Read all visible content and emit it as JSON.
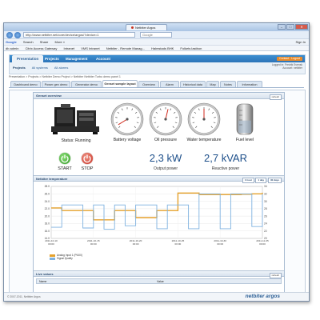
{
  "browser": {
    "tab_title": "Netbiter Argos",
    "url": "http://www.netbiter.net/core/device/argos/?device=1",
    "search_placeholder": "Google",
    "google_toolbar": [
      "Google",
      "Search",
      "Share",
      "More »",
      "Sign In"
    ],
    "favorites": [
      "db admin",
      "Citrix Access Gateway",
      "Intranet",
      "VMS Intranet",
      "Netbiter - Remote Manag...",
      "Halmstads BHK",
      "Folkets lastbon"
    ],
    "window_controls": [
      "–",
      "□",
      "✕"
    ]
  },
  "app": {
    "menu": [
      "Presentation",
      "Projects",
      "Management",
      "Account"
    ],
    "contact_label": "Contact · Logout",
    "subnav": [
      "Projects",
      "All systems",
      "All alarms"
    ],
    "user_line1": "Logged in: Fredrik Svensk",
    "user_line2": "Account: netbiter",
    "breadcrumb": "Presentation > Projects > Netbiter Demo Project > Netbiter Netbiter Turbo demo panel 1"
  },
  "page_tabs": [
    "Dashboard demo",
    "Power gen demo",
    "Generator demo",
    "Genset sample layout",
    "Overview",
    "Alarm",
    "Historical data",
    "Map",
    "Notes",
    "Information"
  ],
  "overview": {
    "title": "Genset overview",
    "button": "refresh",
    "status_label": "Status:",
    "status_value": "Running",
    "gauges": [
      {
        "label": "Battery voltage",
        "level": 0.05
      },
      {
        "label": "Oil pressure",
        "level": 0.55
      },
      {
        "label": "Water temperature",
        "level": 0.5
      }
    ],
    "fuel_label": "Fuel level",
    "fuel_level": 0.45,
    "start_label": "START",
    "stop_label": "STOP",
    "power_value": "2,3 kW",
    "power_label": "Output power",
    "reactive_value": "2,7 kVAR",
    "reactive_label": "Reactive power"
  },
  "temperature": {
    "title": "Netbiter temperature",
    "ranges": [
      "1 hour",
      "1 day",
      "30 days"
    ],
    "legend": [
      "Analog Input 1 (Pt100)",
      "Signal Quality"
    ],
    "colors": {
      "series1": "#e5a12b",
      "series2": "#7fb2e0"
    }
  },
  "chart_data": {
    "type": "line",
    "y_left_ticks": [
      "28.0",
      "26.0",
      "24.0",
      "22.0",
      "20.0",
      "18.0",
      "16.0",
      "14.0"
    ],
    "y_right_ticks": [
      "34",
      "32",
      "30",
      "28",
      "26",
      "24",
      "22",
      "20"
    ],
    "x_ticks": [
      "2011-10-10\n00:00",
      "2011-10-15\n00:00",
      "2011-10-20\n00:00",
      "2011-10-25\n00:00",
      "2011-10-30\n00:00",
      "2011-11-05\n00:00"
    ],
    "series": [
      {
        "name": "Analog Input 1 (Pt100)",
        "values": [
          22.2,
          21.5,
          21.5,
          21.5,
          19.0,
          19.0,
          21.5,
          21.5,
          19.6,
          19.6,
          21.5,
          21.5,
          26.2,
          26.2,
          25.8,
          25.8,
          25.8,
          25.8,
          25.9,
          26.0,
          26.3
        ]
      },
      {
        "name": "Signal Quality",
        "values": [
          17.0,
          23.0,
          23.0,
          16.8,
          23.0,
          16.5,
          23.0,
          17.4,
          23.0,
          23.0,
          16.6,
          23.0,
          23.0,
          16.6,
          26.0,
          26.0,
          16.6,
          26.0,
          26.0,
          17.2,
          26.0
        ]
      }
    ],
    "ylim": [
      14,
      28
    ],
    "grid": true,
    "legend": "bottom-left"
  },
  "live_values": {
    "title": "Live values",
    "button": "refresh",
    "columns": [
      "Name",
      "Value"
    ]
  },
  "footer": {
    "copyright": "© 2007-2011, Netbiter Argos",
    "brand": "netbiter argos"
  }
}
